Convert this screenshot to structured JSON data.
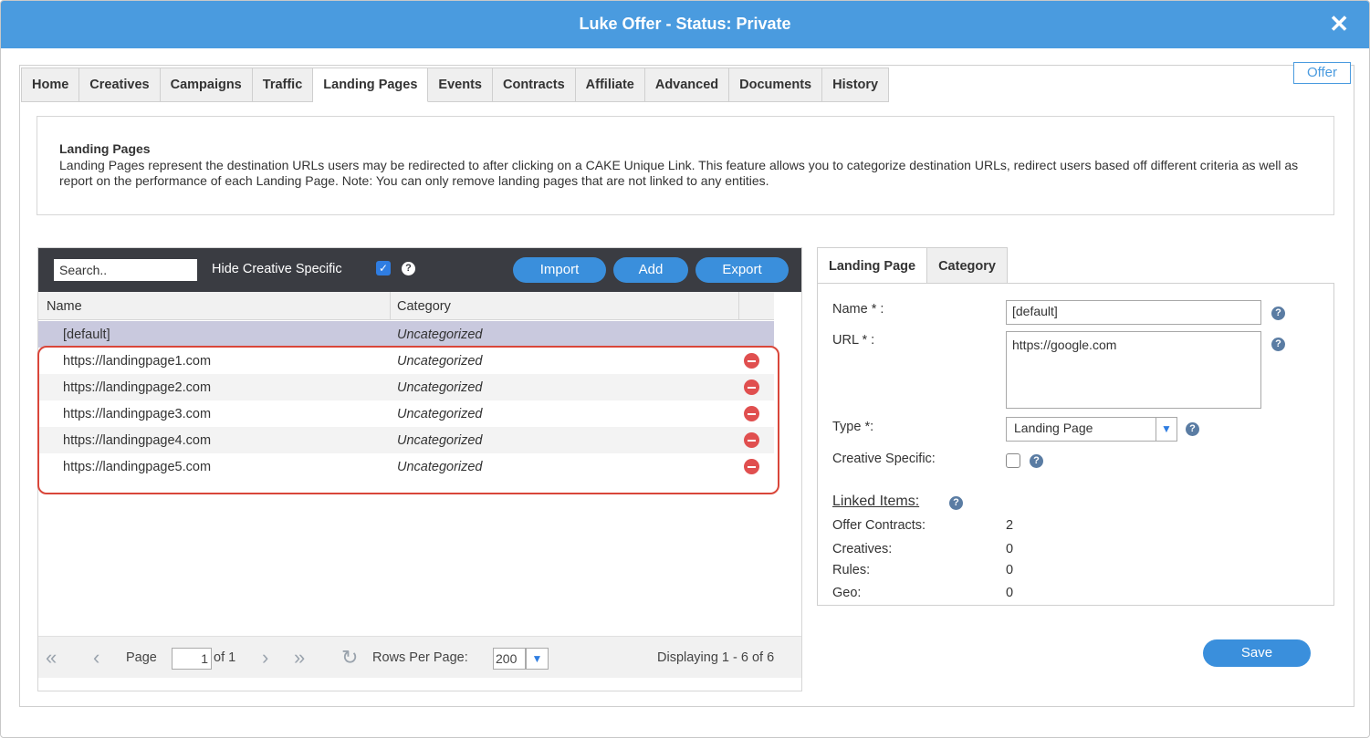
{
  "window": {
    "title": "Luke Offer - Status: Private",
    "close_glyph": "✕"
  },
  "offer_button": "Offer",
  "tabs": [
    {
      "label": "Home"
    },
    {
      "label": "Creatives"
    },
    {
      "label": "Campaigns"
    },
    {
      "label": "Traffic"
    },
    {
      "label": "Landing Pages"
    },
    {
      "label": "Events"
    },
    {
      "label": "Contracts"
    },
    {
      "label": "Affiliate"
    },
    {
      "label": "Advanced"
    },
    {
      "label": "Documents"
    },
    {
      "label": "History"
    }
  ],
  "active_tab": "Landing Pages",
  "info": {
    "heading": "Landing Pages",
    "body": "Landing Pages represent the destination URLs users may be redirected to after clicking on a CAKE Unique Link. This feature allows you to categorize destination URLs, redirect users based off different criteria as well as report on the performance of each Landing Page. Note: You can only remove landing pages that are not linked to any entities."
  },
  "grid": {
    "search_placeholder": "Search..",
    "hide_creative_label": "Hide Creative Specific",
    "hide_creative_checked": true,
    "buttons": {
      "import": "Import",
      "add": "Add",
      "export": "Export"
    },
    "columns": {
      "name": "Name",
      "category": "Category"
    },
    "rows": [
      {
        "name": "[default]",
        "category": "Uncategorized"
      },
      {
        "name": "https://landingpage1.com",
        "category": "Uncategorized"
      },
      {
        "name": "https://landingpage2.com",
        "category": "Uncategorized"
      },
      {
        "name": "https://landingpage3.com",
        "category": "Uncategorized"
      },
      {
        "name": "https://landingpage4.com",
        "category": "Uncategorized"
      },
      {
        "name": "https://landingpage5.com",
        "category": "Uncategorized"
      }
    ],
    "pager": {
      "page_label": "Page",
      "page_value": "1",
      "of_label": "of 1",
      "rows_per_page_label": "Rows Per Page:",
      "rows_per_page_value": "200",
      "displaying": "Displaying 1 - 6 of 6"
    }
  },
  "detail": {
    "tabs": [
      {
        "label": "Landing Page"
      },
      {
        "label": "Category"
      }
    ],
    "name_label": "Name * :",
    "name_value": "[default]",
    "url_label": "URL * :",
    "url_value": "https://google.com",
    "type_label": "Type *:",
    "type_value": "Landing Page",
    "creative_specific_label": "Creative Specific:",
    "linked_items_label": "Linked Items:",
    "linked": [
      {
        "label": "Offer Contracts:",
        "value": "2"
      },
      {
        "label": "Creatives:",
        "value": "0"
      },
      {
        "label": "Rules:",
        "value": "0"
      },
      {
        "label": "Geo:",
        "value": "0"
      }
    ],
    "save": "Save"
  },
  "colors": {
    "titlebar": "#4a9bdf",
    "accent": "#3a8fdc",
    "delete": "#e04f4f",
    "highlight": "#d9463a",
    "selected_row": "#c9c9de"
  }
}
